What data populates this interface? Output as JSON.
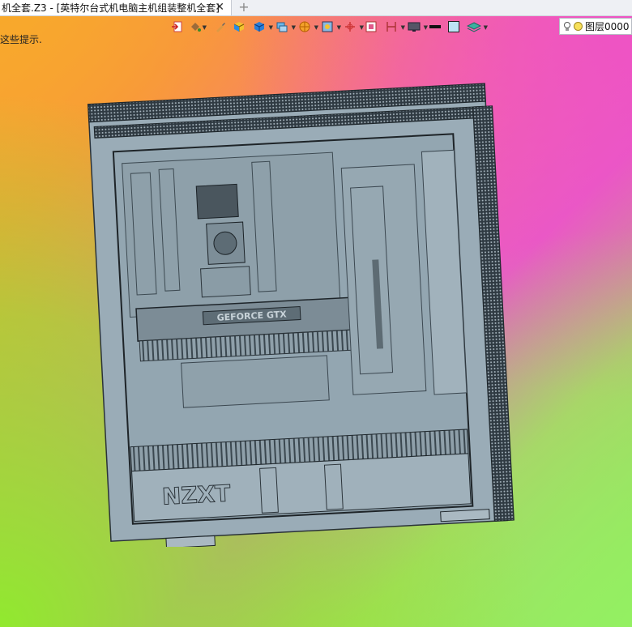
{
  "document_tab": {
    "title": "机全套.Z3 - [英特尔台式机电脑主机组装整机全套]",
    "close": "✕"
  },
  "new_tab": "+",
  "hint_text": "这些提示.",
  "layer": {
    "label": "图层0000"
  },
  "toolbar_icons": [
    "exit-icon",
    "paint-bucket-icon",
    "brush-icon",
    "cube-color-icon",
    "cube-blue-icon",
    "layers-icon",
    "sphere-render-icon",
    "view-icon",
    "axis-icon",
    "frame-icon",
    "boundary-icon",
    "display-icon",
    "line-color-icon",
    "fill-color-icon",
    "layer-stack-icon",
    "bulb-icon",
    "layer-dot-icon"
  ],
  "model": {
    "brand": "NZXT",
    "gpu_label": "GEFORCE GTX"
  }
}
